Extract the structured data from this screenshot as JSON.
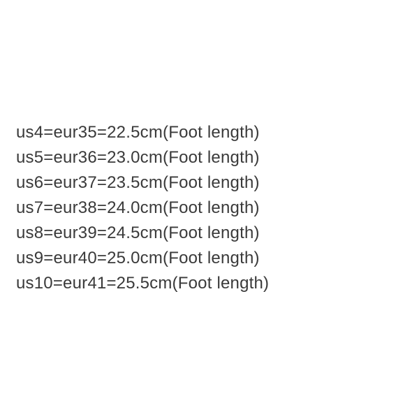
{
  "sizes": [
    {
      "text": "us4=eur35=22.5cm(Foot length)"
    },
    {
      "text": "us5=eur36=23.0cm(Foot length)"
    },
    {
      "text": "us6=eur37=23.5cm(Foot length)"
    },
    {
      "text": "us7=eur38=24.0cm(Foot length)"
    },
    {
      "text": "us8=eur39=24.5cm(Foot length)"
    },
    {
      "text": "us9=eur40=25.0cm(Foot length)"
    },
    {
      "text": "us10=eur41=25.5cm(Foot length)"
    }
  ]
}
